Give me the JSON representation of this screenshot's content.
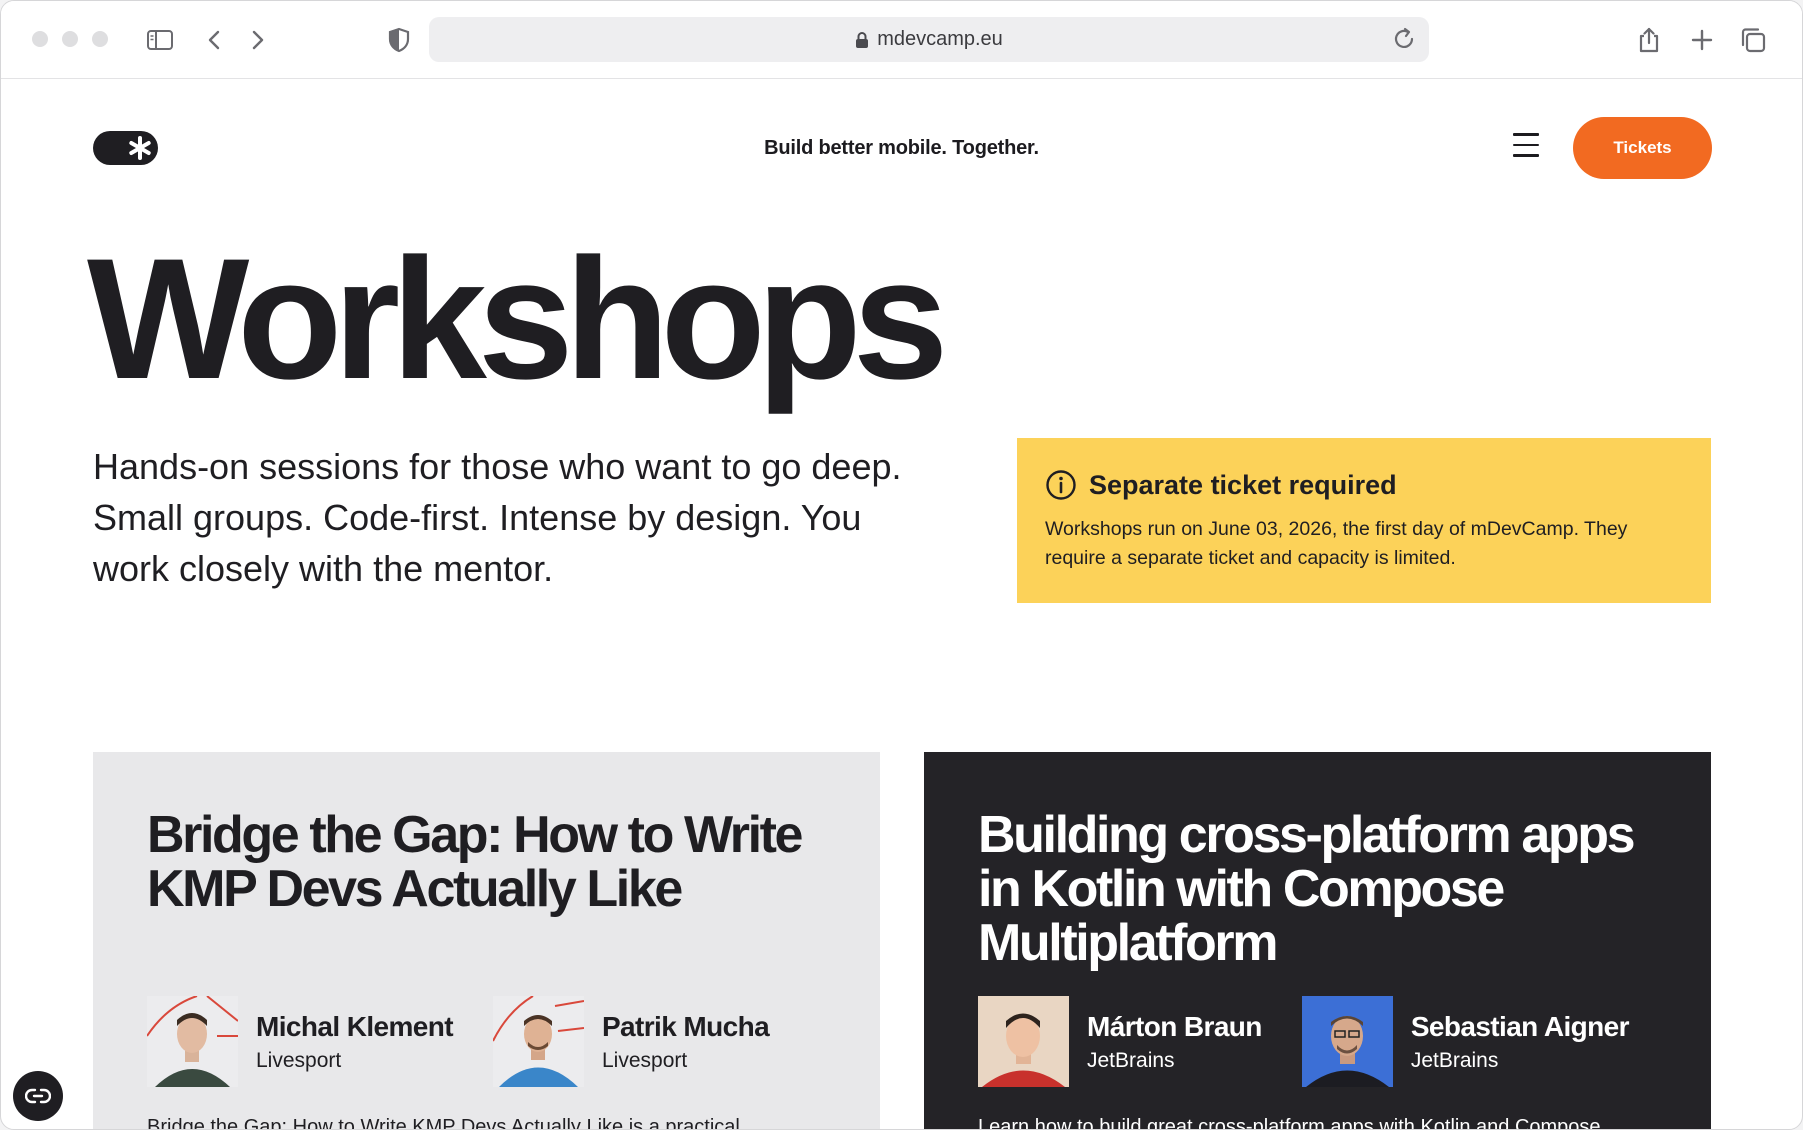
{
  "browser": {
    "url": "mdevcamp.eu"
  },
  "header": {
    "tagline": "Build better mobile. Together.",
    "tickets_label": "Tickets",
    "brand_color": "#f26a21"
  },
  "hero": {
    "title": "Workshops",
    "intro_line1": "Hands-on sessions for those who want to go deep.",
    "intro_line2": "Small groups. Code-first. Intense by design. You work closely with the mentor."
  },
  "notice": {
    "title": "Separate ticket required",
    "text": "Workshops run on June 03, 2026, the first day of mDevCamp. They require a separate ticket and capacity is limited.",
    "color": "#fcd259"
  },
  "workshops": [
    {
      "title": "Bridge the Gap: How to Write KMP Devs Actually Like",
      "speakers": [
        {
          "name": "Michal Klement",
          "company": "Livesport"
        },
        {
          "name": "Patrik Mucha",
          "company": "Livesport"
        }
      ],
      "description": "Bridge the Gap: How to Write KMP Devs Actually Like is a practical"
    },
    {
      "title": "Building cross-platform apps in Kotlin with Compose Multiplatform",
      "speakers": [
        {
          "name": "Márton Braun",
          "company": "JetBrains"
        },
        {
          "name": "Sebastian Aigner",
          "company": "JetBrains"
        }
      ],
      "description": "Learn how to build great cross-platform apps with Kotlin and Compose"
    }
  ]
}
